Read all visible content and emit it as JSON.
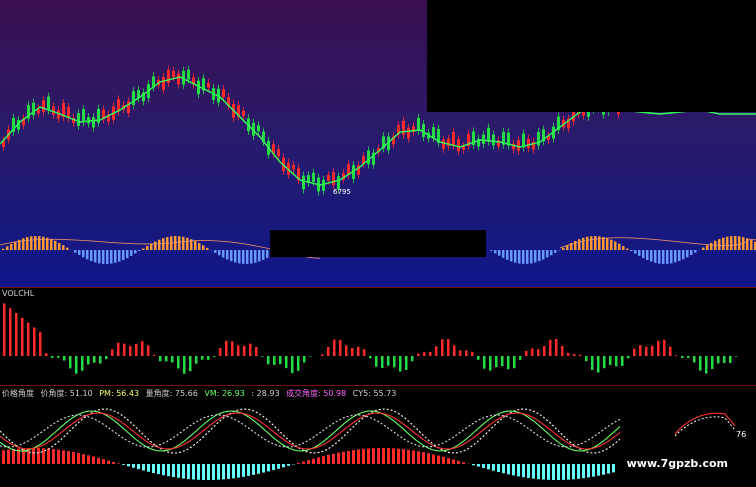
{
  "panels": {
    "volume": {
      "label": "VOLCHL"
    },
    "indicator": {
      "legend": [
        {
          "text": "价格角度",
          "color": "#d0d0d0"
        },
        {
          "text": "价角度: 51.10",
          "color": "#d0d0d0"
        },
        {
          "text": "PM: 56.43",
          "color": "#ffff66"
        },
        {
          "text": "量角度: 75.66",
          "color": "#d0d0d0"
        },
        {
          "text": "VM: 26.93",
          "color": "#66ff66"
        },
        {
          "text": ": 28.93",
          "color": "#d0d0d0"
        },
        {
          "text": "成交角度: 50.98",
          "color": "#ff66ff"
        },
        {
          "text": "CY5: 55.73",
          "color": "#d0d0d0"
        }
      ],
      "value_tag": "76"
    }
  },
  "price_tag": "6795",
  "watermark": "www.7gpzb.com",
  "colors": {
    "up": "#ff2a2a",
    "down": "#22dd44",
    "ma": "#33ff55",
    "cyan": "#66ffff",
    "yellow": "#ffff66"
  }
}
